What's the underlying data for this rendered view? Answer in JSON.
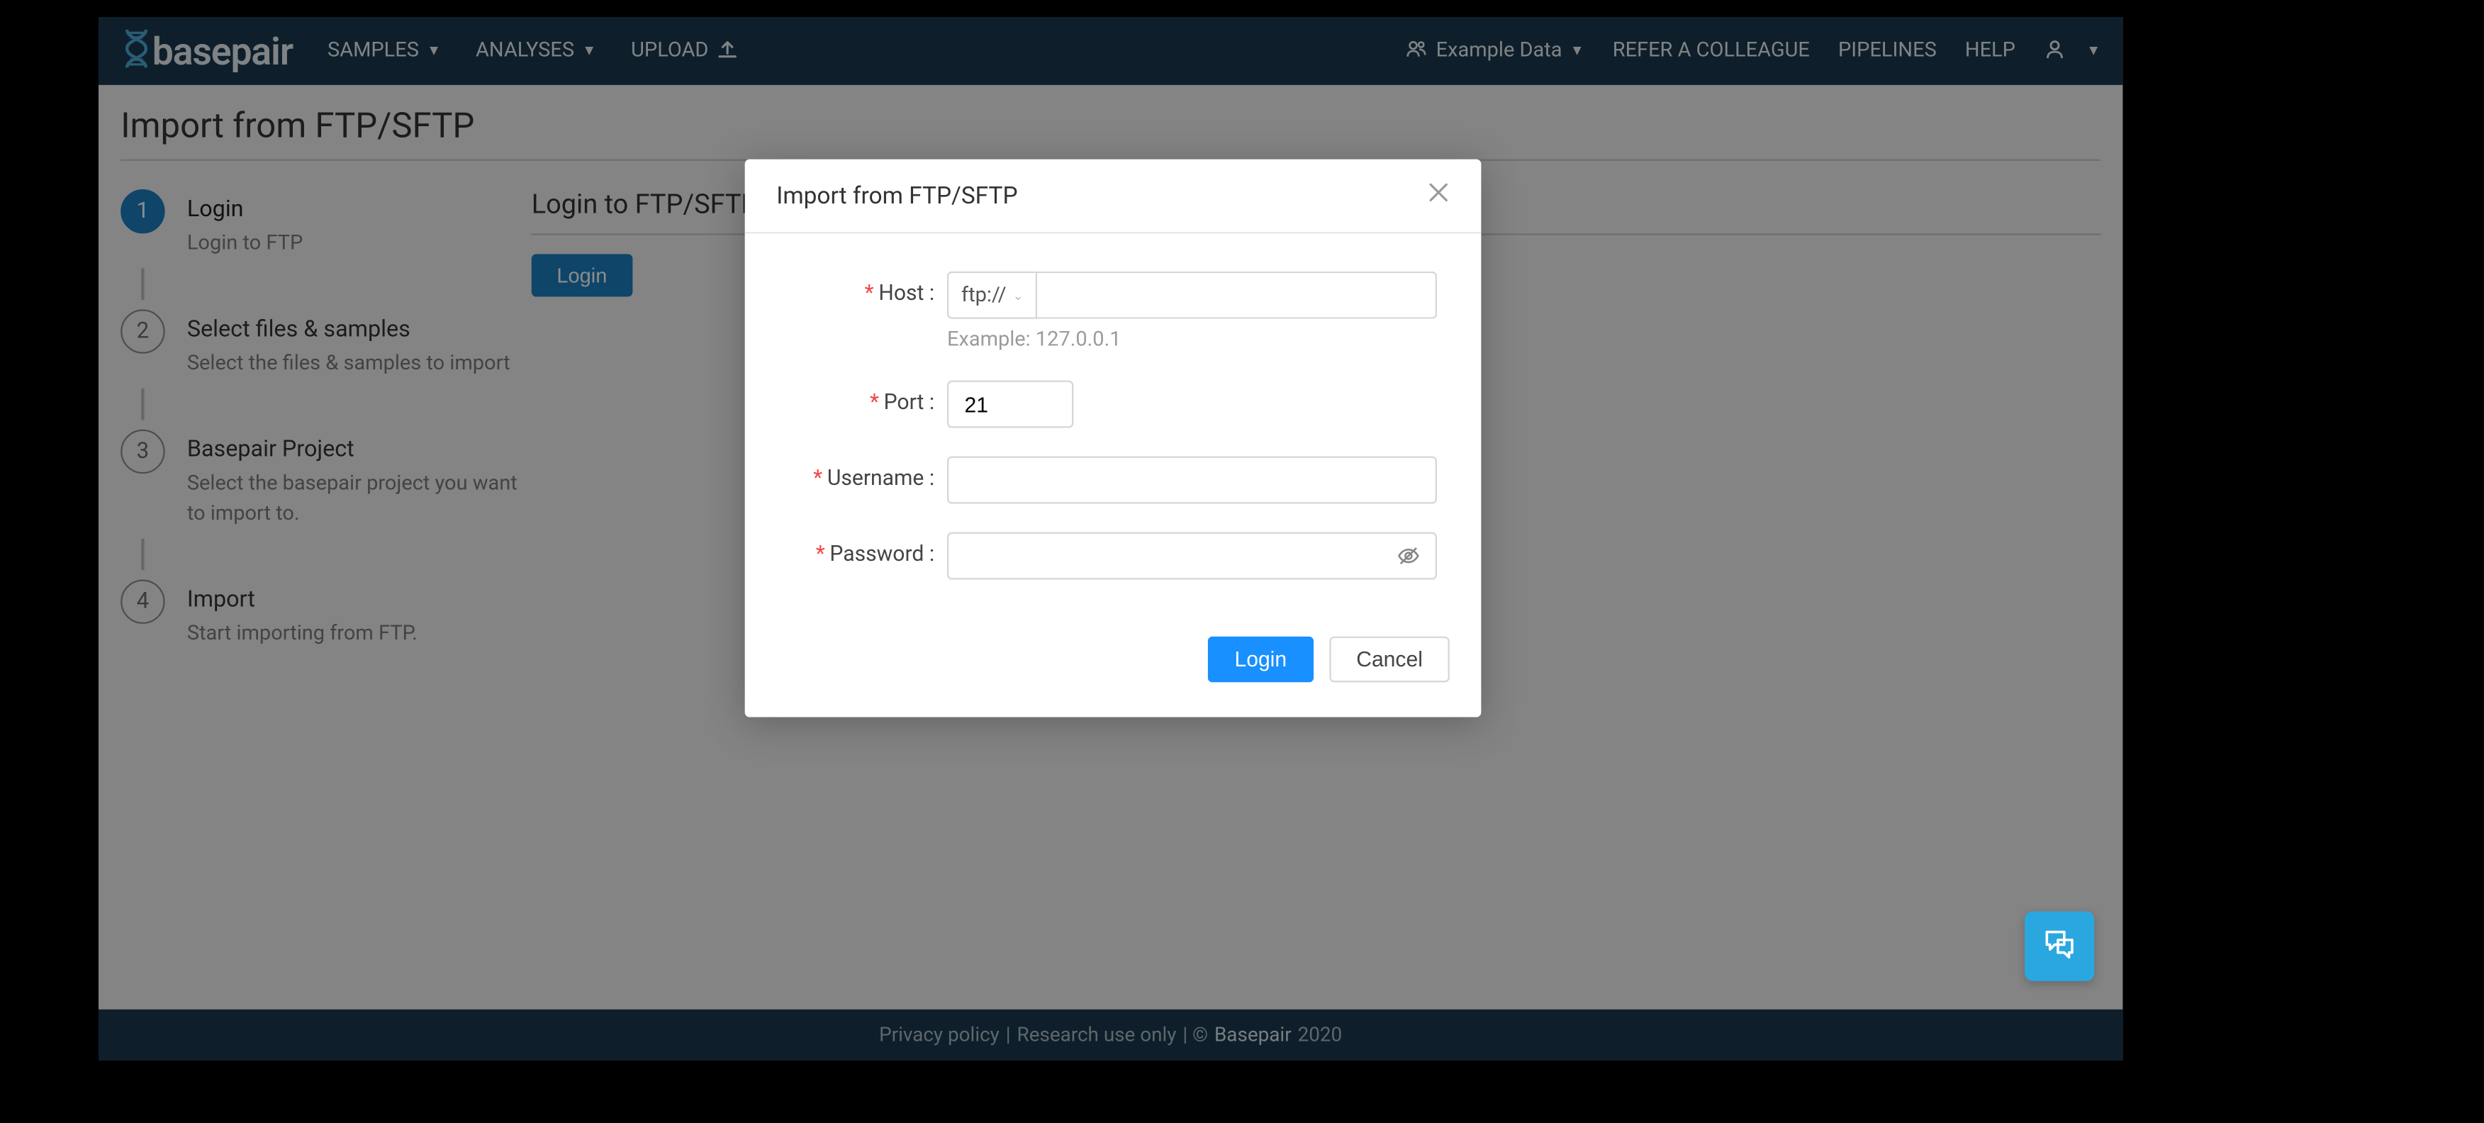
{
  "brand": {
    "name": "basepair"
  },
  "nav": {
    "left": [
      {
        "label": "SAMPLES"
      },
      {
        "label": "ANALYSES"
      },
      {
        "label": "UPLOAD"
      }
    ],
    "projectSelector": "Example Data",
    "right": [
      {
        "label": "REFER A COLLEAGUE"
      },
      {
        "label": "PIPELINES"
      },
      {
        "label": "HELP"
      }
    ]
  },
  "page": {
    "title": "Import from FTP/SFTP",
    "sectionTitle": "Login to FTP/SFTP",
    "loginBtn": "Login"
  },
  "steps": [
    {
      "num": "1",
      "title": "Login",
      "desc": "Login to FTP"
    },
    {
      "num": "2",
      "title": "Select files & samples",
      "desc": "Select the files & samples to import"
    },
    {
      "num": "3",
      "title": "Basepair Project",
      "desc": "Select the basepair project you want to import to."
    },
    {
      "num": "4",
      "title": "Import",
      "desc": "Start importing from FTP."
    }
  ],
  "modal": {
    "title": "Import from FTP/SFTP",
    "fields": {
      "host": {
        "label": "Host",
        "protocol": "ftp://",
        "help": "Example: 127.0.0.1",
        "value": ""
      },
      "port": {
        "label": "Port",
        "value": "21"
      },
      "username": {
        "label": "Username",
        "value": ""
      },
      "password": {
        "label": "Password",
        "value": ""
      }
    },
    "actions": {
      "login": "Login",
      "cancel": "Cancel"
    }
  },
  "footer": {
    "privacy": "Privacy policy",
    "research": "Research use only",
    "brand": "Basepair",
    "year": "2020"
  }
}
